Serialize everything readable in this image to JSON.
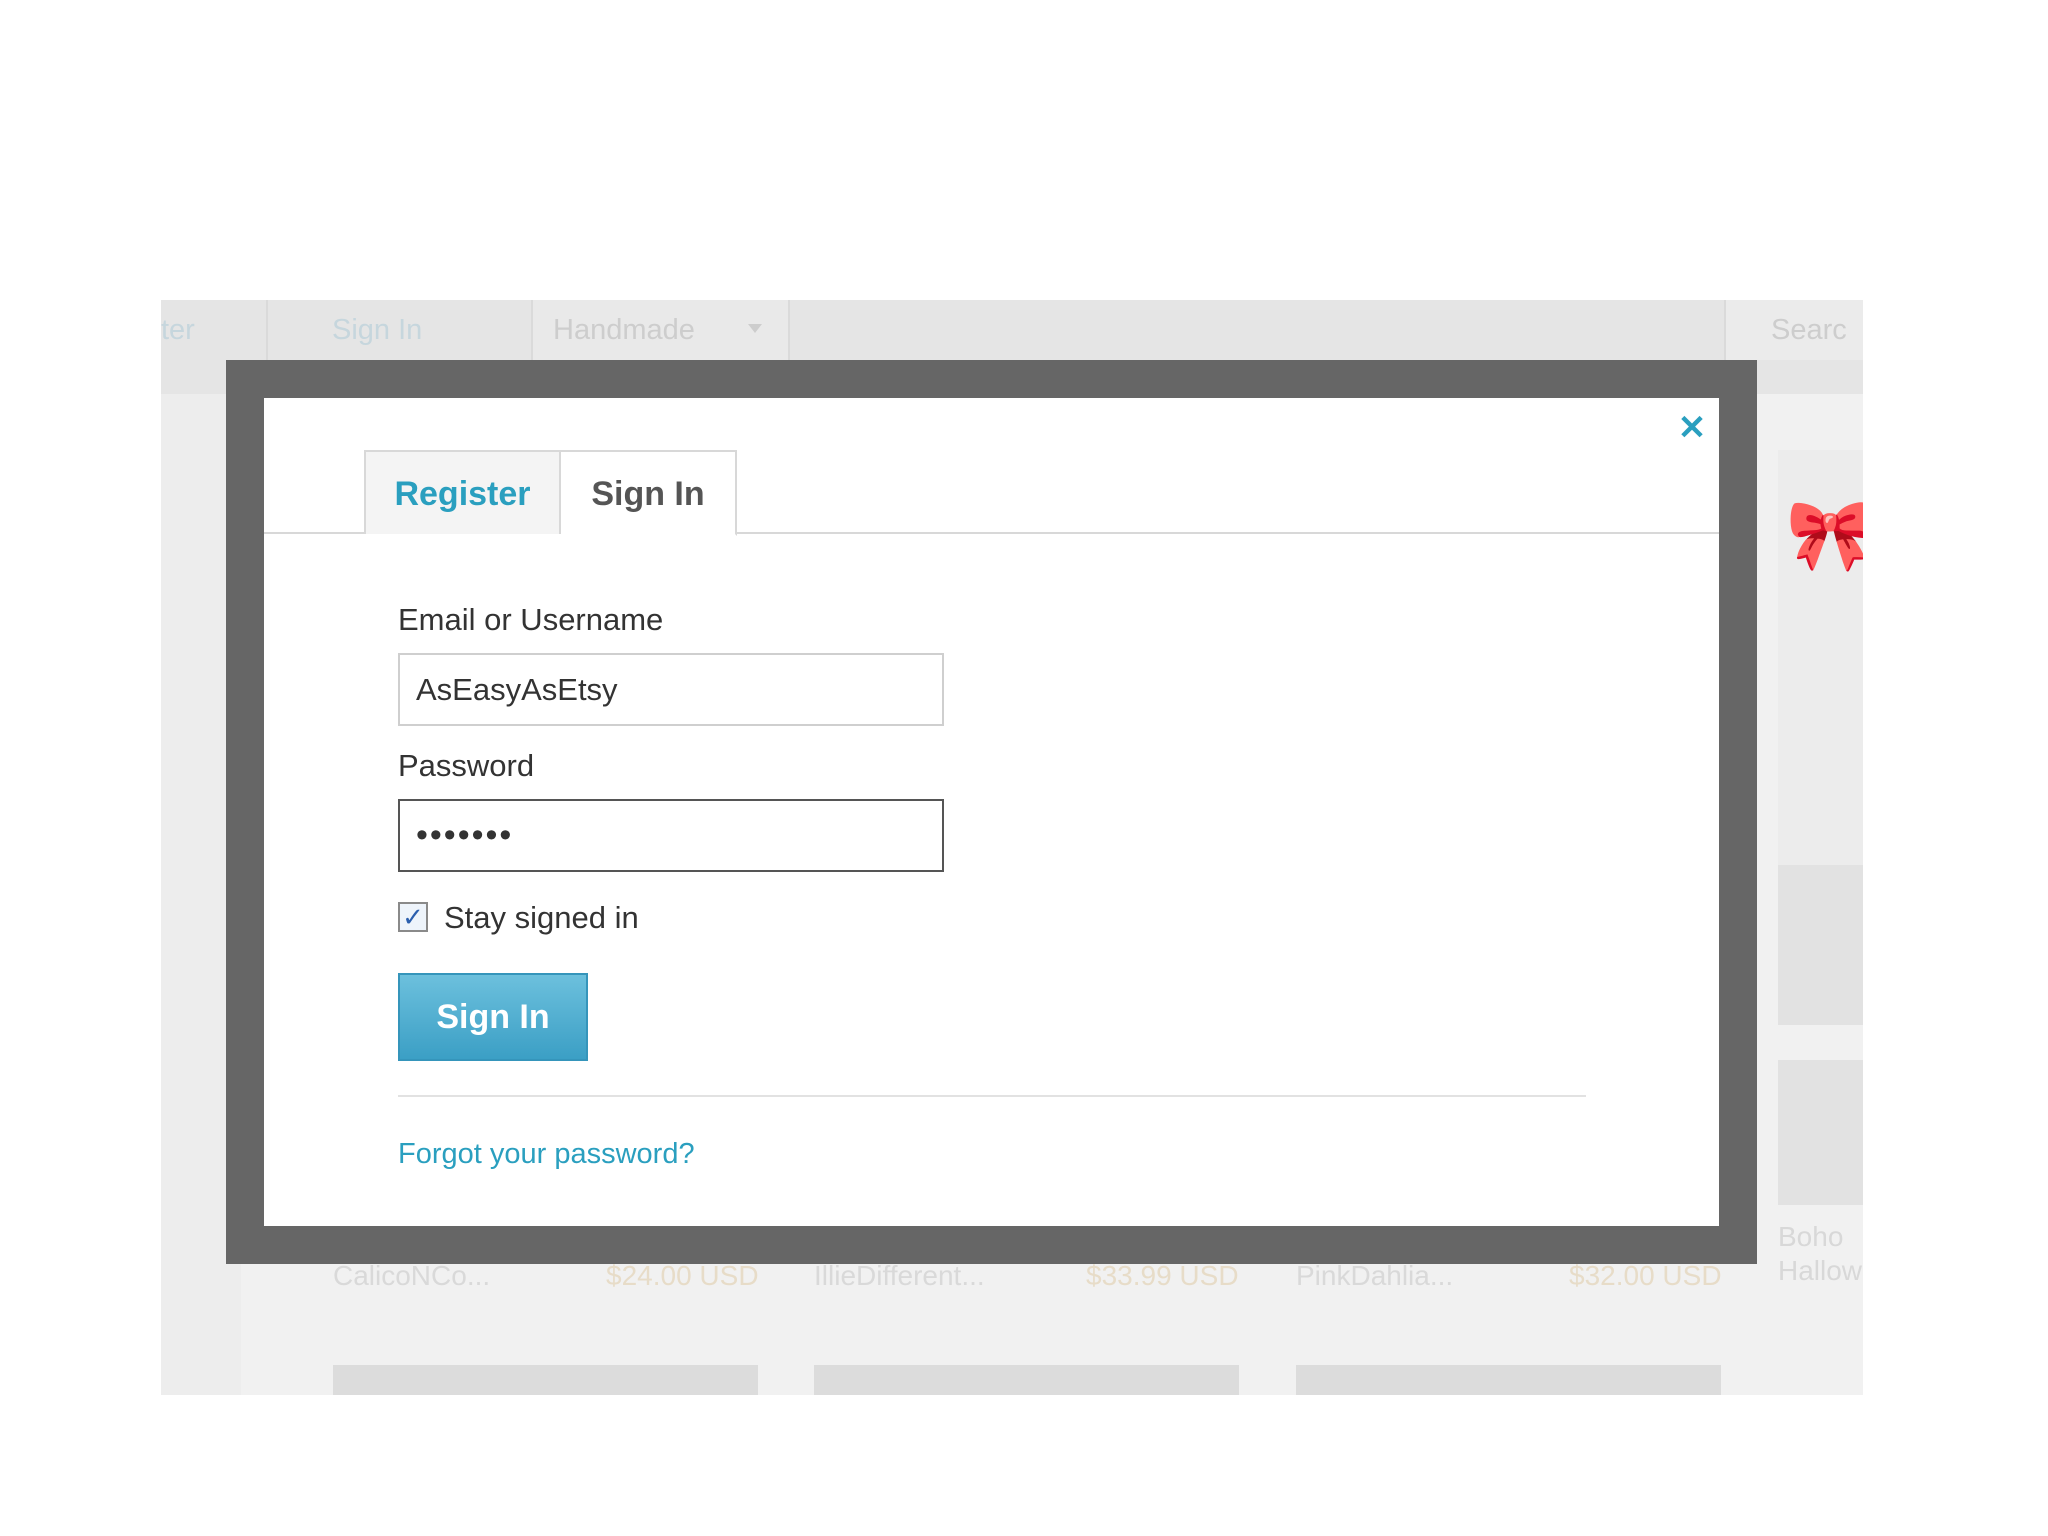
{
  "background_page": {
    "nav": {
      "register_fragment": "ter",
      "signin": "Sign In",
      "category": "Handmade",
      "search": "Searc"
    },
    "items": [
      {
        "shop": "CalicoNCo...",
        "price": "$24.00 USD"
      },
      {
        "shop": "IllieDifferent...",
        "price": "$33.99 USD"
      },
      {
        "shop": "PinkDahlia...",
        "price": "$32.00 USD"
      }
    ],
    "side_item": {
      "line1": "Boho",
      "line2": "Hallow"
    }
  },
  "modal": {
    "close_glyph": "✕",
    "tabs": [
      {
        "label": "Register",
        "active": false
      },
      {
        "label": "Sign In",
        "active": true
      }
    ],
    "email": {
      "label": "Email or Username",
      "value": "AsEasyAsEtsy"
    },
    "password": {
      "label": "Password",
      "value": "•••••••"
    },
    "stay_signed_in": {
      "label": "Stay signed in",
      "checked": true,
      "check_glyph": "✓"
    },
    "submit_label": "Sign In",
    "forgot_link": "Forgot your password?"
  },
  "colors": {
    "accent": "#2a9fbf",
    "button": "#45a9cc",
    "overlay_frame": "#666666"
  },
  "icons": {
    "close": "close-icon",
    "checkbox": "checkbox-checked-icon",
    "caret": "chevron-down-icon",
    "gift": "gift-bow-icon"
  }
}
